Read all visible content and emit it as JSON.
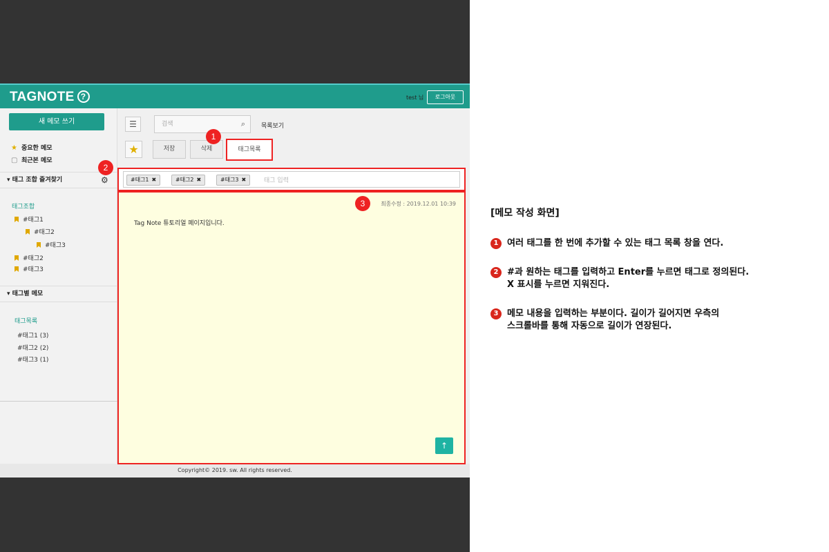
{
  "app": {
    "logo": "TAGNOTE",
    "help_icon": "?",
    "user_text": "test 님",
    "logout": "로그아웃"
  },
  "sidebar": {
    "new_memo": "새 메모 쓰기",
    "important": "중요한 메모",
    "recent": "최근본 메모",
    "favorites_section": "태그 조합 즐겨찾기",
    "combo_title": "태그조합",
    "combo_tags": [
      "#태그1",
      "#태그2",
      "#태그3",
      "#태그2",
      "#태그3"
    ],
    "by_tag_section": "태그별 메모",
    "taglist_title": "태그목록",
    "tag_counts": [
      "#태그1  (3)",
      "#태그2  (2)",
      "#태그3  (1)"
    ]
  },
  "toolbar": {
    "search_placeholder": "검색",
    "list_view": "목록보기",
    "save": "저장",
    "delete": "삭제",
    "taglist": "태그목록"
  },
  "tags": {
    "chips": [
      "#태그1",
      "#태그2",
      "#태그3"
    ],
    "input_placeholder": "태그 입력"
  },
  "memo": {
    "modified": "최종수정 : 2019.12.01 10:39",
    "content": "Tag Note 튜토리얼 페이지입니다."
  },
  "footer": "Copyright© 2019. sw. All rights reserved.",
  "markers": [
    "1",
    "2",
    "3"
  ],
  "panel": {
    "title": "[메모 작성 화면]",
    "notes": [
      {
        "num": "1",
        "text": "여러 태그를 한 번에 추가할 수 있는 태그 목록 창을 연다."
      },
      {
        "num": "2",
        "text": "#과 원하는 태그를 입력하고 Enter를 누르면 태그로 정의된다.\nX 표시를 누르면 지워진다."
      },
      {
        "num": "3",
        "text": "메모 내용을 입력하는 부분이다. 길이가 길어지면 우측의\n스크롤바를 통해 자동으로 길이가 연장된다."
      }
    ]
  },
  "colors": {
    "accent": "#1f9c8c",
    "highlight": "#ee2222",
    "memo_bg": "#fefee0"
  }
}
